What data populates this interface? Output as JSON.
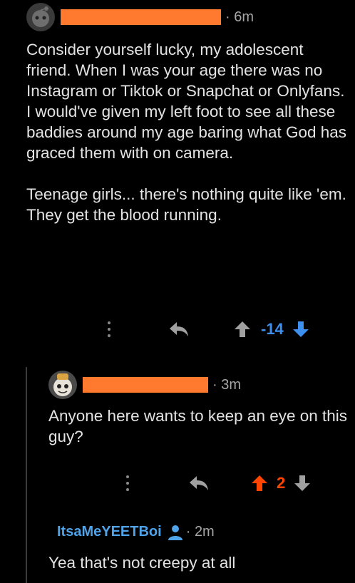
{
  "comments": [
    {
      "avatar_icon": "snoo-avatar-icon",
      "username_redacted": true,
      "time": "6m",
      "paragraphs": [
        "Consider yourself lucky, my adolescent friend. When I was your age there was no Instagram or Tiktok or Snapchat or Onlyfans. I would've given my left foot to see all these baddies around my age baring what God has graced them with on camera.",
        "Teenage girls... there's nothing quite like 'em. They get the blood running."
      ],
      "score": "-14",
      "vote_state": "downvoted"
    },
    {
      "avatar_icon": "snoo-avatar-icon",
      "username_redacted": true,
      "time": "3m",
      "paragraphs": [
        "Anyone here wants to keep an eye on this guy?"
      ],
      "score": "2",
      "vote_state": "upvoted"
    },
    {
      "username": "ItsaMeYEETBoi",
      "op_icon": "user-icon",
      "time": "2m",
      "paragraphs": [
        "Yea that's not creepy at all"
      ]
    }
  ],
  "separator": "·",
  "colors": {
    "background": "#000000",
    "text": "#e3e3e3",
    "meta": "#a7a7a7",
    "redaction": "#ff7a2f",
    "upvote_active": "#ff4500",
    "downvote_active": "#3d8ff0",
    "username_link": "#4fa3e8",
    "icon_gray": "#a0a0a0"
  }
}
